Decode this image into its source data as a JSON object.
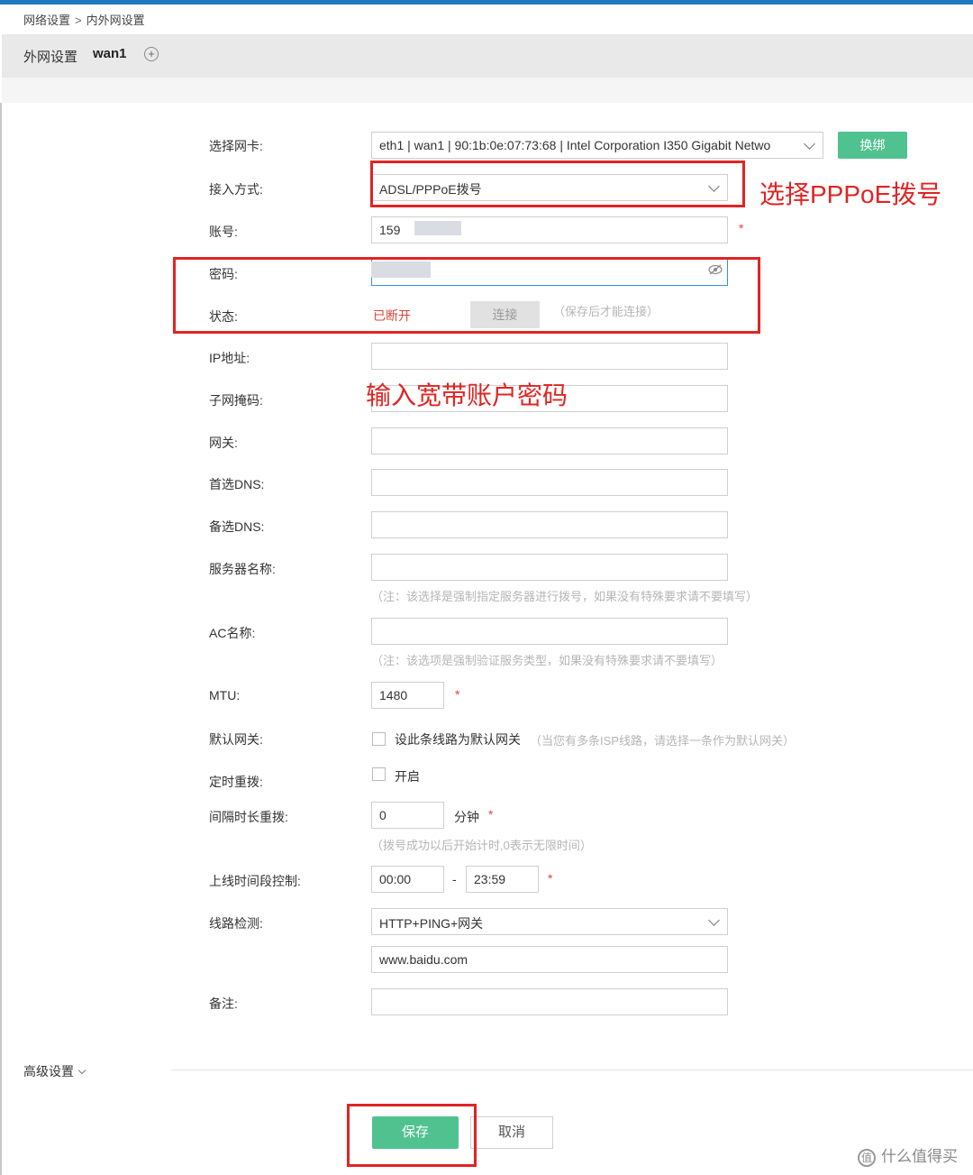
{
  "breadcrumb": {
    "level1": "网络设置",
    "separator": ">",
    "level2": "内外网设置"
  },
  "header": {
    "title": "外网设置",
    "interface": "wan1",
    "add_icon": "plus-circle-icon"
  },
  "form": {
    "nic": {
      "label": "选择网卡:",
      "value": "eth1 | wan1 | 90:1b:0e:07:73:68 | Intel Corporation I350 Gigabit Netwo",
      "bind_button": "换绑"
    },
    "access_mode": {
      "label": "接入方式:",
      "value": "ADSL/PPPoE拨号"
    },
    "account": {
      "label": "账号:",
      "value": "159",
      "required": "*"
    },
    "password": {
      "label": "密码:",
      "value": "",
      "eye_icon": "eye-slash-icon"
    },
    "status": {
      "label": "状态:",
      "value": "已断开",
      "connect_button": "连接",
      "hint": "（保存后才能连接）"
    },
    "ip": {
      "label": "IP地址:",
      "value": ""
    },
    "mask": {
      "label": "子网掩码:",
      "value": ""
    },
    "gateway": {
      "label": "网关:",
      "value": ""
    },
    "dns1": {
      "label": "首选DNS:",
      "value": ""
    },
    "dns2": {
      "label": "备选DNS:",
      "value": ""
    },
    "server_name": {
      "label": "服务器名称:",
      "value": "",
      "hint": "（注：该选择是强制指定服务器进行拨号，如果没有特殊要求请不要填写）"
    },
    "ac_name": {
      "label": "AC名称:",
      "value": "",
      "hint": "（注：该选项是强制验证服务类型，如果没有特殊要求请不要填写）"
    },
    "mtu": {
      "label": "MTU:",
      "value": "1480",
      "required": "*"
    },
    "default_gw": {
      "label": "默认网关:",
      "checkbox_label": "设此条线路为默认网关",
      "hint": "（当您有多条ISP线路，请选择一条作为默认网关）"
    },
    "timed_redial": {
      "label": "定时重拨:",
      "checkbox_label": "开启"
    },
    "interval_redial": {
      "label": "间隔时长重拨:",
      "value": "0",
      "unit": "分钟",
      "required": "*",
      "hint": "（拨号成功以后开始计时,0表示无限时间）"
    },
    "online_time": {
      "label": "上线时间段控制:",
      "start": "00:00",
      "dash": "-",
      "end": "23:59",
      "required": "*"
    },
    "line_check": {
      "label": "线路检测:",
      "value": "HTTP+PING+网关",
      "url": "www.baidu.com"
    },
    "remark": {
      "label": "备注:",
      "value": ""
    }
  },
  "advanced": {
    "label": "高级设置"
  },
  "actions": {
    "save": "保存",
    "cancel": "取消"
  },
  "annotations": {
    "select_pppoe": "选择PPPoE拨号",
    "enter_password": "输入宽带账户密码"
  },
  "watermark": {
    "icon_text": "值",
    "text": "什么值得买"
  },
  "colors": {
    "accent_green": "#4fc28f",
    "annotation_red": "#e02424",
    "top_blue": "#1f78c1"
  }
}
